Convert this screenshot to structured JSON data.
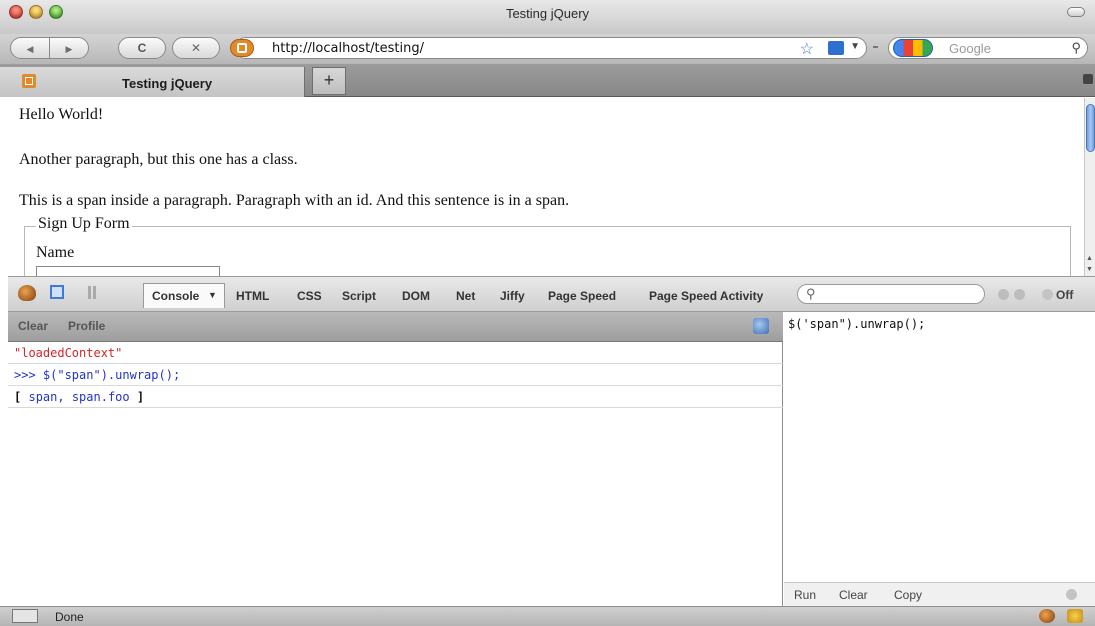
{
  "window": {
    "title": "Testing jQuery"
  },
  "toolbar": {
    "back_glyph": "◀",
    "forward_glyph": "▶",
    "reload_glyph": "C",
    "stop_glyph": "✕",
    "url": "http://localhost/testing/",
    "search_placeholder": "Google"
  },
  "tabs": {
    "active_label": "Testing jQuery",
    "new_tab_glyph": "+"
  },
  "page": {
    "lines": [
      "Hello World!",
      "Another paragraph, but this one has a class.",
      "This is a span inside a paragraph. Paragraph with an id. And this sentence is in a span."
    ],
    "fieldset_legend": "Sign Up Form",
    "name_label": "Name"
  },
  "firebug": {
    "tabs": [
      "HTML",
      "CSS",
      "Script",
      "DOM",
      "Net",
      "Jiffy",
      "Page Speed",
      "Page Speed Activity"
    ],
    "active_tab": "Console",
    "off_label": "Off",
    "sub_toolbar": {
      "clear": "Clear",
      "profile": "Profile"
    },
    "log": [
      {
        "text": "\"loadedContext\"",
        "color": "#d4252b"
      },
      {
        "text": ">>> $(\"span\").unwrap();",
        "color": "#2433c8"
      }
    ],
    "result": {
      "open": "[",
      "item1": "span,",
      "item2": "span.foo",
      "close": "]"
    },
    "command_editor": "$('span\").unwrap();",
    "footer": {
      "run": "Run",
      "clear": "Clear",
      "copy": "Copy"
    }
  },
  "status": {
    "text": "Done"
  }
}
